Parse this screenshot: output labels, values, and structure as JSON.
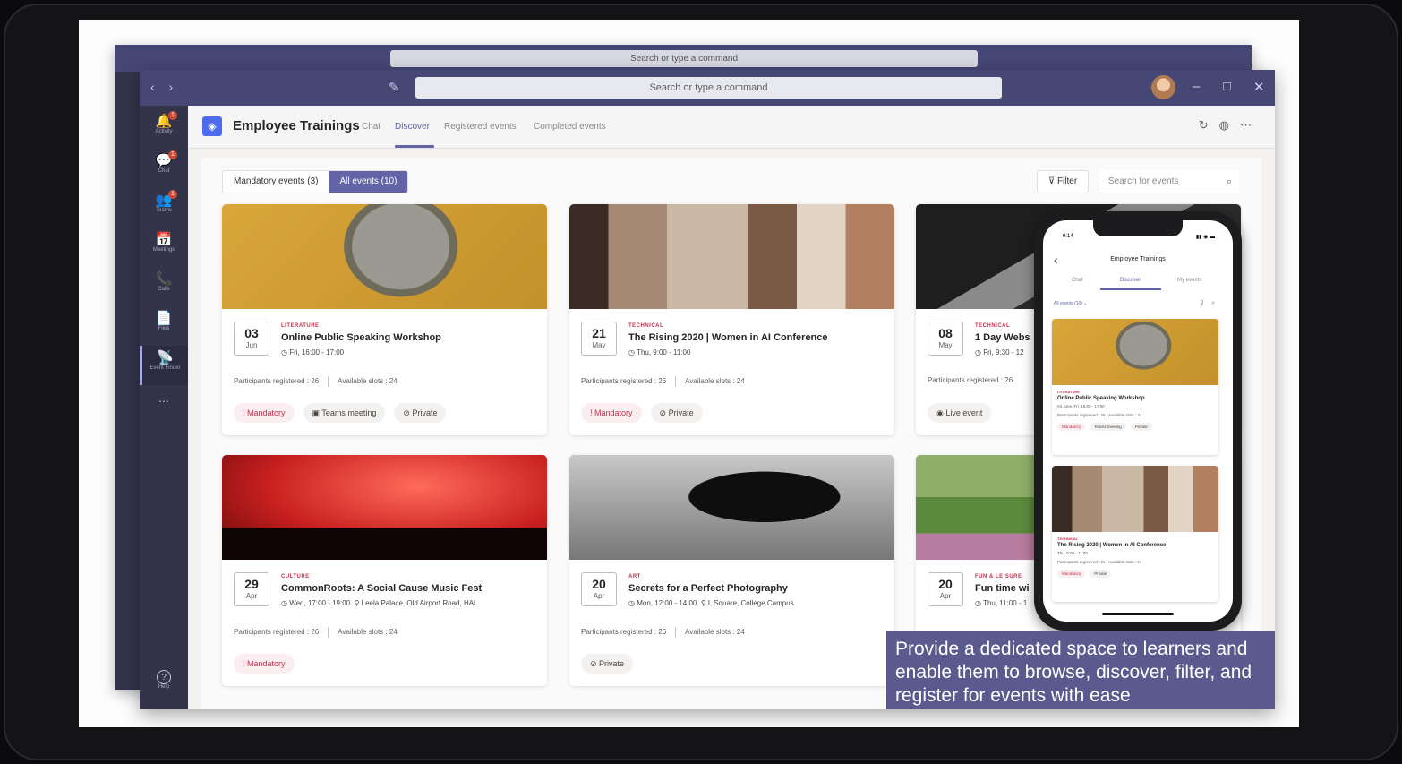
{
  "window": {
    "search_placeholder": "Search or type a command",
    "nav": "‹ ›",
    "controls": [
      "–",
      "□",
      "✕"
    ]
  },
  "rail": [
    {
      "label": "Activity",
      "icon": "bell-icon",
      "glyph": "🔔",
      "badge": "1"
    },
    {
      "label": "Chat",
      "icon": "chat-icon",
      "glyph": "💬",
      "badge": "1"
    },
    {
      "label": "Teams",
      "icon": "teams-icon",
      "glyph": "👥",
      "badge": "1"
    },
    {
      "label": "Meetings",
      "icon": "calendar-icon",
      "glyph": "📅",
      "badge": ""
    },
    {
      "label": "Calls",
      "icon": "phone-icon",
      "glyph": "📞",
      "badge": ""
    },
    {
      "label": "Files",
      "icon": "file-icon",
      "glyph": "📄",
      "badge": ""
    },
    {
      "label": "Event Finder",
      "icon": "event-finder-icon",
      "glyph": "📡",
      "badge": ""
    }
  ],
  "rail_more": "...",
  "rail_help": {
    "label": "Help",
    "glyph": "?"
  },
  "app": {
    "title": "Employee Trainings",
    "tabs": [
      "Chat",
      "Discover",
      "Registered events",
      "Completed events"
    ],
    "active_tab": "Discover"
  },
  "toolbar": {
    "mandatory_label": "Mandatory events (3)",
    "all_label": "All events (10)",
    "filter_label": "Filter",
    "search_placeholder": "Search for events"
  },
  "events": [
    {
      "day": "03",
      "month": "Jun",
      "category": "LITERATURE",
      "title": "Online Public Speaking Workshop",
      "time": "Fri, 16:00 - 17:00",
      "location": "",
      "registered": "Participants registered : 26",
      "slots": "Available slots : 24",
      "chips": [
        "Mandatory",
        "Teams meeting",
        "Private"
      ]
    },
    {
      "day": "21",
      "month": "May",
      "category": "TECHNICAL",
      "title": "The Rising 2020 | Women in AI Conference",
      "time": "Thu, 9:00 - 11:00",
      "location": "",
      "registered": "Participants registered : 26",
      "slots": "Available slots : 24",
      "chips": [
        "Mandatory",
        "Private"
      ]
    },
    {
      "day": "08",
      "month": "May",
      "category": "TECHNICAL",
      "title": "1 Day Webs",
      "time": "Fri, 9:30 - 12",
      "location": "",
      "registered": "Participants registered : 26",
      "slots": "",
      "chips": [
        "Live event"
      ]
    },
    {
      "day": "29",
      "month": "Apr",
      "category": "CULTURE",
      "title": "CommonRoots: A Social Cause Music Fest",
      "time": "Wed, 17:00 - 19:00",
      "location": "Leela Palace, Old Airport Road, HAL",
      "registered": "Participants registered : 26",
      "slots": "Available slots : 24",
      "chips": [
        "Mandatory"
      ]
    },
    {
      "day": "20",
      "month": "Apr",
      "category": "ART",
      "title": "Secrets for a Perfect Photography",
      "time": "Mon, 12:00 - 14:00",
      "location": "L Square, College Campus",
      "registered": "Participants registered : 26",
      "slots": "Available slots : 24",
      "chips": [
        "Private"
      ]
    },
    {
      "day": "20",
      "month": "Apr",
      "category": "FUN & LEISURE",
      "title": "Fun time wi",
      "time": "Thu, 11:00 - 1",
      "location": "",
      "registered": "",
      "slots": "",
      "chips": []
    }
  ],
  "phone": {
    "time": "9:14",
    "signal": "▮▮ ◉ ▬",
    "title": "Employee Trainings",
    "tabs": [
      "Chat",
      "Discover",
      "My events"
    ],
    "filter": "All events (10) ⌄",
    "cards": [
      {
        "category": "LITERATURE",
        "title": "Online Public Speaking Workshop",
        "time": "03 June, Fri, 16:00 - 17:00",
        "stats": "Participants registered : 26   |   Available slots : 24",
        "chips": [
          "Mandatory",
          "Teams meeting",
          "Private"
        ]
      },
      {
        "category": "TECHNICAL",
        "title": "The Rising 2020 | Women in AI Conference",
        "time": "Thu, 9:00 - 11:00",
        "stats": "Participants registered : 26   |   Available slots : 24",
        "chips": [
          "Mandatory",
          "Private"
        ]
      }
    ]
  },
  "caption": "Provide a dedicated space to learners and enable them to browse, discover, filter, and register for events with ease",
  "colors": {
    "brand": "#464775",
    "accent": "#6264a7",
    "mandatory": "#c4314b"
  }
}
